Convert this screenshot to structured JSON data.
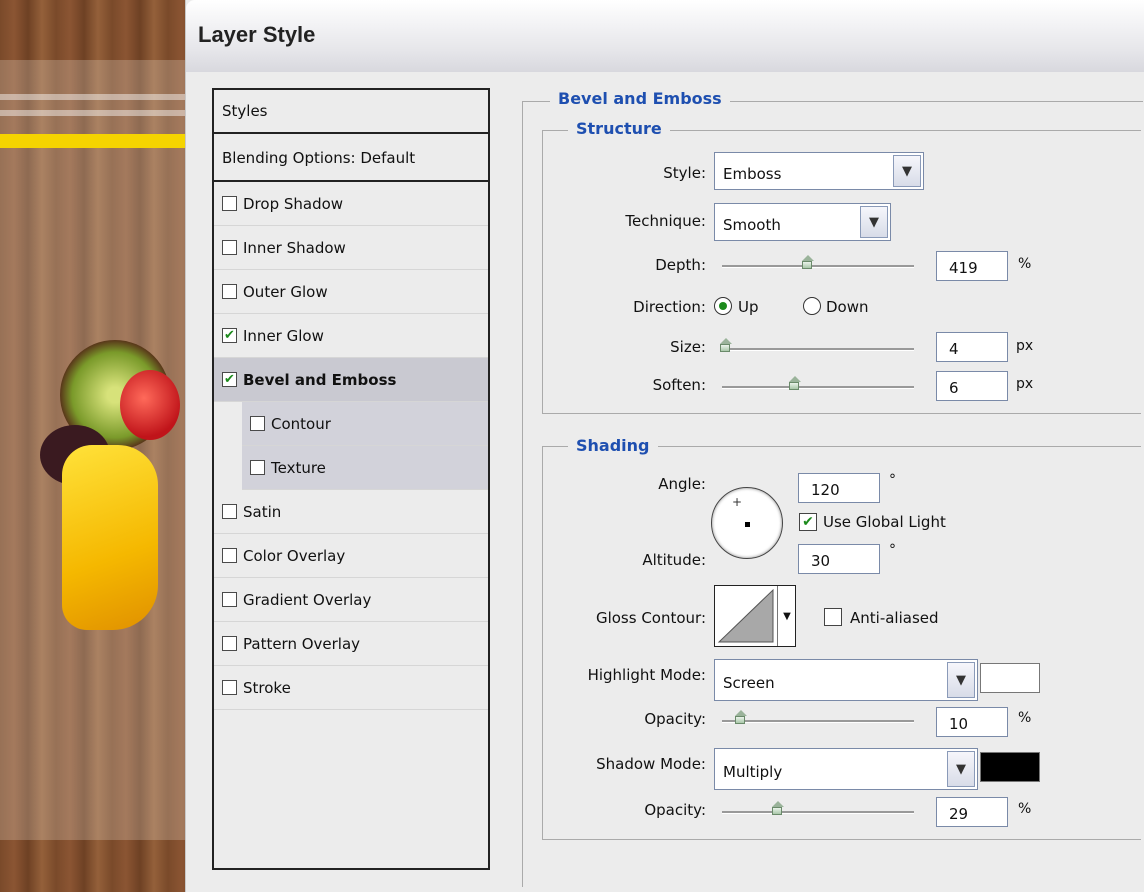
{
  "window": {
    "title": "Layer Style"
  },
  "styles_panel": {
    "header": "Styles",
    "blending": "Blending Options: Default",
    "items": [
      {
        "label": "Drop Shadow",
        "checked": false
      },
      {
        "label": "Inner Shadow",
        "checked": false
      },
      {
        "label": "Outer Glow",
        "checked": false
      },
      {
        "label": "Inner Glow",
        "checked": true
      },
      {
        "label": "Bevel and Emboss",
        "checked": true
      },
      {
        "label": "Contour",
        "checked": false
      },
      {
        "label": "Texture",
        "checked": false
      },
      {
        "label": "Satin",
        "checked": false
      },
      {
        "label": "Color Overlay",
        "checked": false
      },
      {
        "label": "Gradient Overlay",
        "checked": false
      },
      {
        "label": "Pattern Overlay",
        "checked": false
      },
      {
        "label": "Stroke",
        "checked": false
      }
    ]
  },
  "bevel": {
    "title": "Bevel and Emboss",
    "structure": {
      "title": "Structure",
      "style_label": "Style:",
      "style_value": "Emboss",
      "technique_label": "Technique:",
      "technique_value": "Smooth",
      "depth_label": "Depth:",
      "depth_value": "419",
      "depth_unit": "%",
      "depth_slider": 0.45,
      "direction_label": "Direction:",
      "direction_up": "Up",
      "direction_down": "Down",
      "size_label": "Size:",
      "size_value": "4",
      "size_unit": "px",
      "size_slider": 0.02,
      "soften_label": "Soften:",
      "soften_value": "6",
      "soften_unit": "px",
      "soften_slider": 0.38
    },
    "shading": {
      "title": "Shading",
      "angle_label": "Angle:",
      "angle_value": "120",
      "degree": "°",
      "use_global_light": "Use Global Light",
      "altitude_label": "Altitude:",
      "altitude_value": "30",
      "gloss_contour_label": "Gloss Contour:",
      "anti_aliased": "Anti-aliased",
      "highlight_mode_label": "Highlight Mode:",
      "highlight_mode_value": "Screen",
      "highlight_color": "#ffffff",
      "highlight_opacity_label": "Opacity:",
      "highlight_opacity_value": "10",
      "highlight_opacity_slider": 0.1,
      "opacity_unit": "%",
      "shadow_mode_label": "Shadow Mode:",
      "shadow_mode_value": "Multiply",
      "shadow_color": "#000000",
      "shadow_opacity_label": "Opacity:",
      "shadow_opacity_value": "29",
      "shadow_opacity_slider": 0.29
    }
  }
}
